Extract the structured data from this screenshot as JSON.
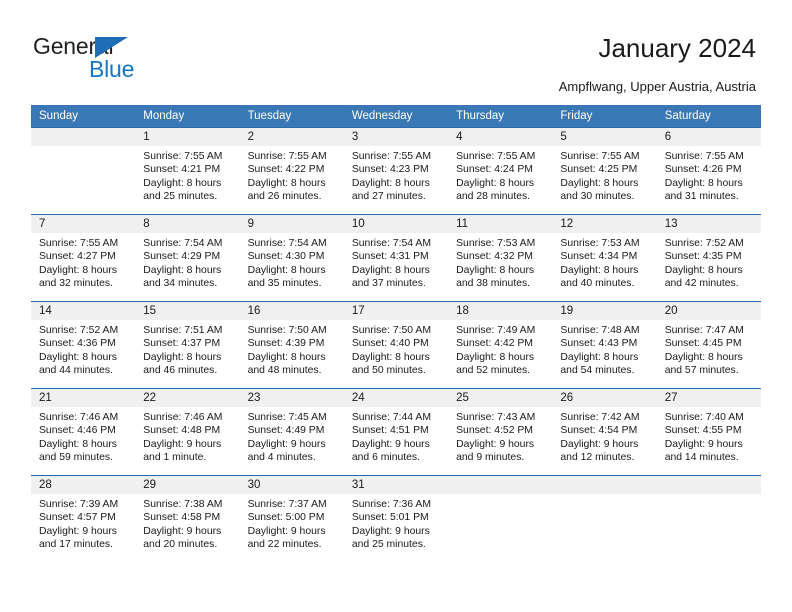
{
  "brand": {
    "name_part1": "General",
    "name_part2": "Blue",
    "triangle_color": "#1f6eb5",
    "blue_color": "#1277c4"
  },
  "header": {
    "title": "January 2024",
    "subtitle": "Ampflwang, Upper Austria, Austria",
    "header_bg": "#3a78b5",
    "row_border": "#2b6aa8",
    "daynum_bg": "#f0f0f0"
  },
  "weekdays": [
    "Sunday",
    "Monday",
    "Tuesday",
    "Wednesday",
    "Thursday",
    "Friday",
    "Saturday"
  ],
  "weeks": [
    [
      {
        "day": "",
        "sunrise": "",
        "sunset": "",
        "daylight1": "",
        "daylight2": "",
        "empty": true
      },
      {
        "day": "1",
        "sunrise": "Sunrise: 7:55 AM",
        "sunset": "Sunset: 4:21 PM",
        "daylight1": "Daylight: 8 hours",
        "daylight2": "and 25 minutes."
      },
      {
        "day": "2",
        "sunrise": "Sunrise: 7:55 AM",
        "sunset": "Sunset: 4:22 PM",
        "daylight1": "Daylight: 8 hours",
        "daylight2": "and 26 minutes."
      },
      {
        "day": "3",
        "sunrise": "Sunrise: 7:55 AM",
        "sunset": "Sunset: 4:23 PM",
        "daylight1": "Daylight: 8 hours",
        "daylight2": "and 27 minutes."
      },
      {
        "day": "4",
        "sunrise": "Sunrise: 7:55 AM",
        "sunset": "Sunset: 4:24 PM",
        "daylight1": "Daylight: 8 hours",
        "daylight2": "and 28 minutes."
      },
      {
        "day": "5",
        "sunrise": "Sunrise: 7:55 AM",
        "sunset": "Sunset: 4:25 PM",
        "daylight1": "Daylight: 8 hours",
        "daylight2": "and 30 minutes."
      },
      {
        "day": "6",
        "sunrise": "Sunrise: 7:55 AM",
        "sunset": "Sunset: 4:26 PM",
        "daylight1": "Daylight: 8 hours",
        "daylight2": "and 31 minutes."
      }
    ],
    [
      {
        "day": "7",
        "sunrise": "Sunrise: 7:55 AM",
        "sunset": "Sunset: 4:27 PM",
        "daylight1": "Daylight: 8 hours",
        "daylight2": "and 32 minutes."
      },
      {
        "day": "8",
        "sunrise": "Sunrise: 7:54 AM",
        "sunset": "Sunset: 4:29 PM",
        "daylight1": "Daylight: 8 hours",
        "daylight2": "and 34 minutes."
      },
      {
        "day": "9",
        "sunrise": "Sunrise: 7:54 AM",
        "sunset": "Sunset: 4:30 PM",
        "daylight1": "Daylight: 8 hours",
        "daylight2": "and 35 minutes."
      },
      {
        "day": "10",
        "sunrise": "Sunrise: 7:54 AM",
        "sunset": "Sunset: 4:31 PM",
        "daylight1": "Daylight: 8 hours",
        "daylight2": "and 37 minutes."
      },
      {
        "day": "11",
        "sunrise": "Sunrise: 7:53 AM",
        "sunset": "Sunset: 4:32 PM",
        "daylight1": "Daylight: 8 hours",
        "daylight2": "and 38 minutes."
      },
      {
        "day": "12",
        "sunrise": "Sunrise: 7:53 AM",
        "sunset": "Sunset: 4:34 PM",
        "daylight1": "Daylight: 8 hours",
        "daylight2": "and 40 minutes."
      },
      {
        "day": "13",
        "sunrise": "Sunrise: 7:52 AM",
        "sunset": "Sunset: 4:35 PM",
        "daylight1": "Daylight: 8 hours",
        "daylight2": "and 42 minutes."
      }
    ],
    [
      {
        "day": "14",
        "sunrise": "Sunrise: 7:52 AM",
        "sunset": "Sunset: 4:36 PM",
        "daylight1": "Daylight: 8 hours",
        "daylight2": "and 44 minutes."
      },
      {
        "day": "15",
        "sunrise": "Sunrise: 7:51 AM",
        "sunset": "Sunset: 4:37 PM",
        "daylight1": "Daylight: 8 hours",
        "daylight2": "and 46 minutes."
      },
      {
        "day": "16",
        "sunrise": "Sunrise: 7:50 AM",
        "sunset": "Sunset: 4:39 PM",
        "daylight1": "Daylight: 8 hours",
        "daylight2": "and 48 minutes."
      },
      {
        "day": "17",
        "sunrise": "Sunrise: 7:50 AM",
        "sunset": "Sunset: 4:40 PM",
        "daylight1": "Daylight: 8 hours",
        "daylight2": "and 50 minutes."
      },
      {
        "day": "18",
        "sunrise": "Sunrise: 7:49 AM",
        "sunset": "Sunset: 4:42 PM",
        "daylight1": "Daylight: 8 hours",
        "daylight2": "and 52 minutes."
      },
      {
        "day": "19",
        "sunrise": "Sunrise: 7:48 AM",
        "sunset": "Sunset: 4:43 PM",
        "daylight1": "Daylight: 8 hours",
        "daylight2": "and 54 minutes."
      },
      {
        "day": "20",
        "sunrise": "Sunrise: 7:47 AM",
        "sunset": "Sunset: 4:45 PM",
        "daylight1": "Daylight: 8 hours",
        "daylight2": "and 57 minutes."
      }
    ],
    [
      {
        "day": "21",
        "sunrise": "Sunrise: 7:46 AM",
        "sunset": "Sunset: 4:46 PM",
        "daylight1": "Daylight: 8 hours",
        "daylight2": "and 59 minutes."
      },
      {
        "day": "22",
        "sunrise": "Sunrise: 7:46 AM",
        "sunset": "Sunset: 4:48 PM",
        "daylight1": "Daylight: 9 hours",
        "daylight2": "and 1 minute."
      },
      {
        "day": "23",
        "sunrise": "Sunrise: 7:45 AM",
        "sunset": "Sunset: 4:49 PM",
        "daylight1": "Daylight: 9 hours",
        "daylight2": "and 4 minutes."
      },
      {
        "day": "24",
        "sunrise": "Sunrise: 7:44 AM",
        "sunset": "Sunset: 4:51 PM",
        "daylight1": "Daylight: 9 hours",
        "daylight2": "and 6 minutes."
      },
      {
        "day": "25",
        "sunrise": "Sunrise: 7:43 AM",
        "sunset": "Sunset: 4:52 PM",
        "daylight1": "Daylight: 9 hours",
        "daylight2": "and 9 minutes."
      },
      {
        "day": "26",
        "sunrise": "Sunrise: 7:42 AM",
        "sunset": "Sunset: 4:54 PM",
        "daylight1": "Daylight: 9 hours",
        "daylight2": "and 12 minutes."
      },
      {
        "day": "27",
        "sunrise": "Sunrise: 7:40 AM",
        "sunset": "Sunset: 4:55 PM",
        "daylight1": "Daylight: 9 hours",
        "daylight2": "and 14 minutes."
      }
    ],
    [
      {
        "day": "28",
        "sunrise": "Sunrise: 7:39 AM",
        "sunset": "Sunset: 4:57 PM",
        "daylight1": "Daylight: 9 hours",
        "daylight2": "and 17 minutes."
      },
      {
        "day": "29",
        "sunrise": "Sunrise: 7:38 AM",
        "sunset": "Sunset: 4:58 PM",
        "daylight1": "Daylight: 9 hours",
        "daylight2": "and 20 minutes."
      },
      {
        "day": "30",
        "sunrise": "Sunrise: 7:37 AM",
        "sunset": "Sunset: 5:00 PM",
        "daylight1": "Daylight: 9 hours",
        "daylight2": "and 22 minutes."
      },
      {
        "day": "31",
        "sunrise": "Sunrise: 7:36 AM",
        "sunset": "Sunset: 5:01 PM",
        "daylight1": "Daylight: 9 hours",
        "daylight2": "and 25 minutes."
      },
      {
        "day": "",
        "sunrise": "",
        "sunset": "",
        "daylight1": "",
        "daylight2": "",
        "empty": true
      },
      {
        "day": "",
        "sunrise": "",
        "sunset": "",
        "daylight1": "",
        "daylight2": "",
        "empty": true
      },
      {
        "day": "",
        "sunrise": "",
        "sunset": "",
        "daylight1": "",
        "daylight2": "",
        "empty": true
      }
    ]
  ]
}
